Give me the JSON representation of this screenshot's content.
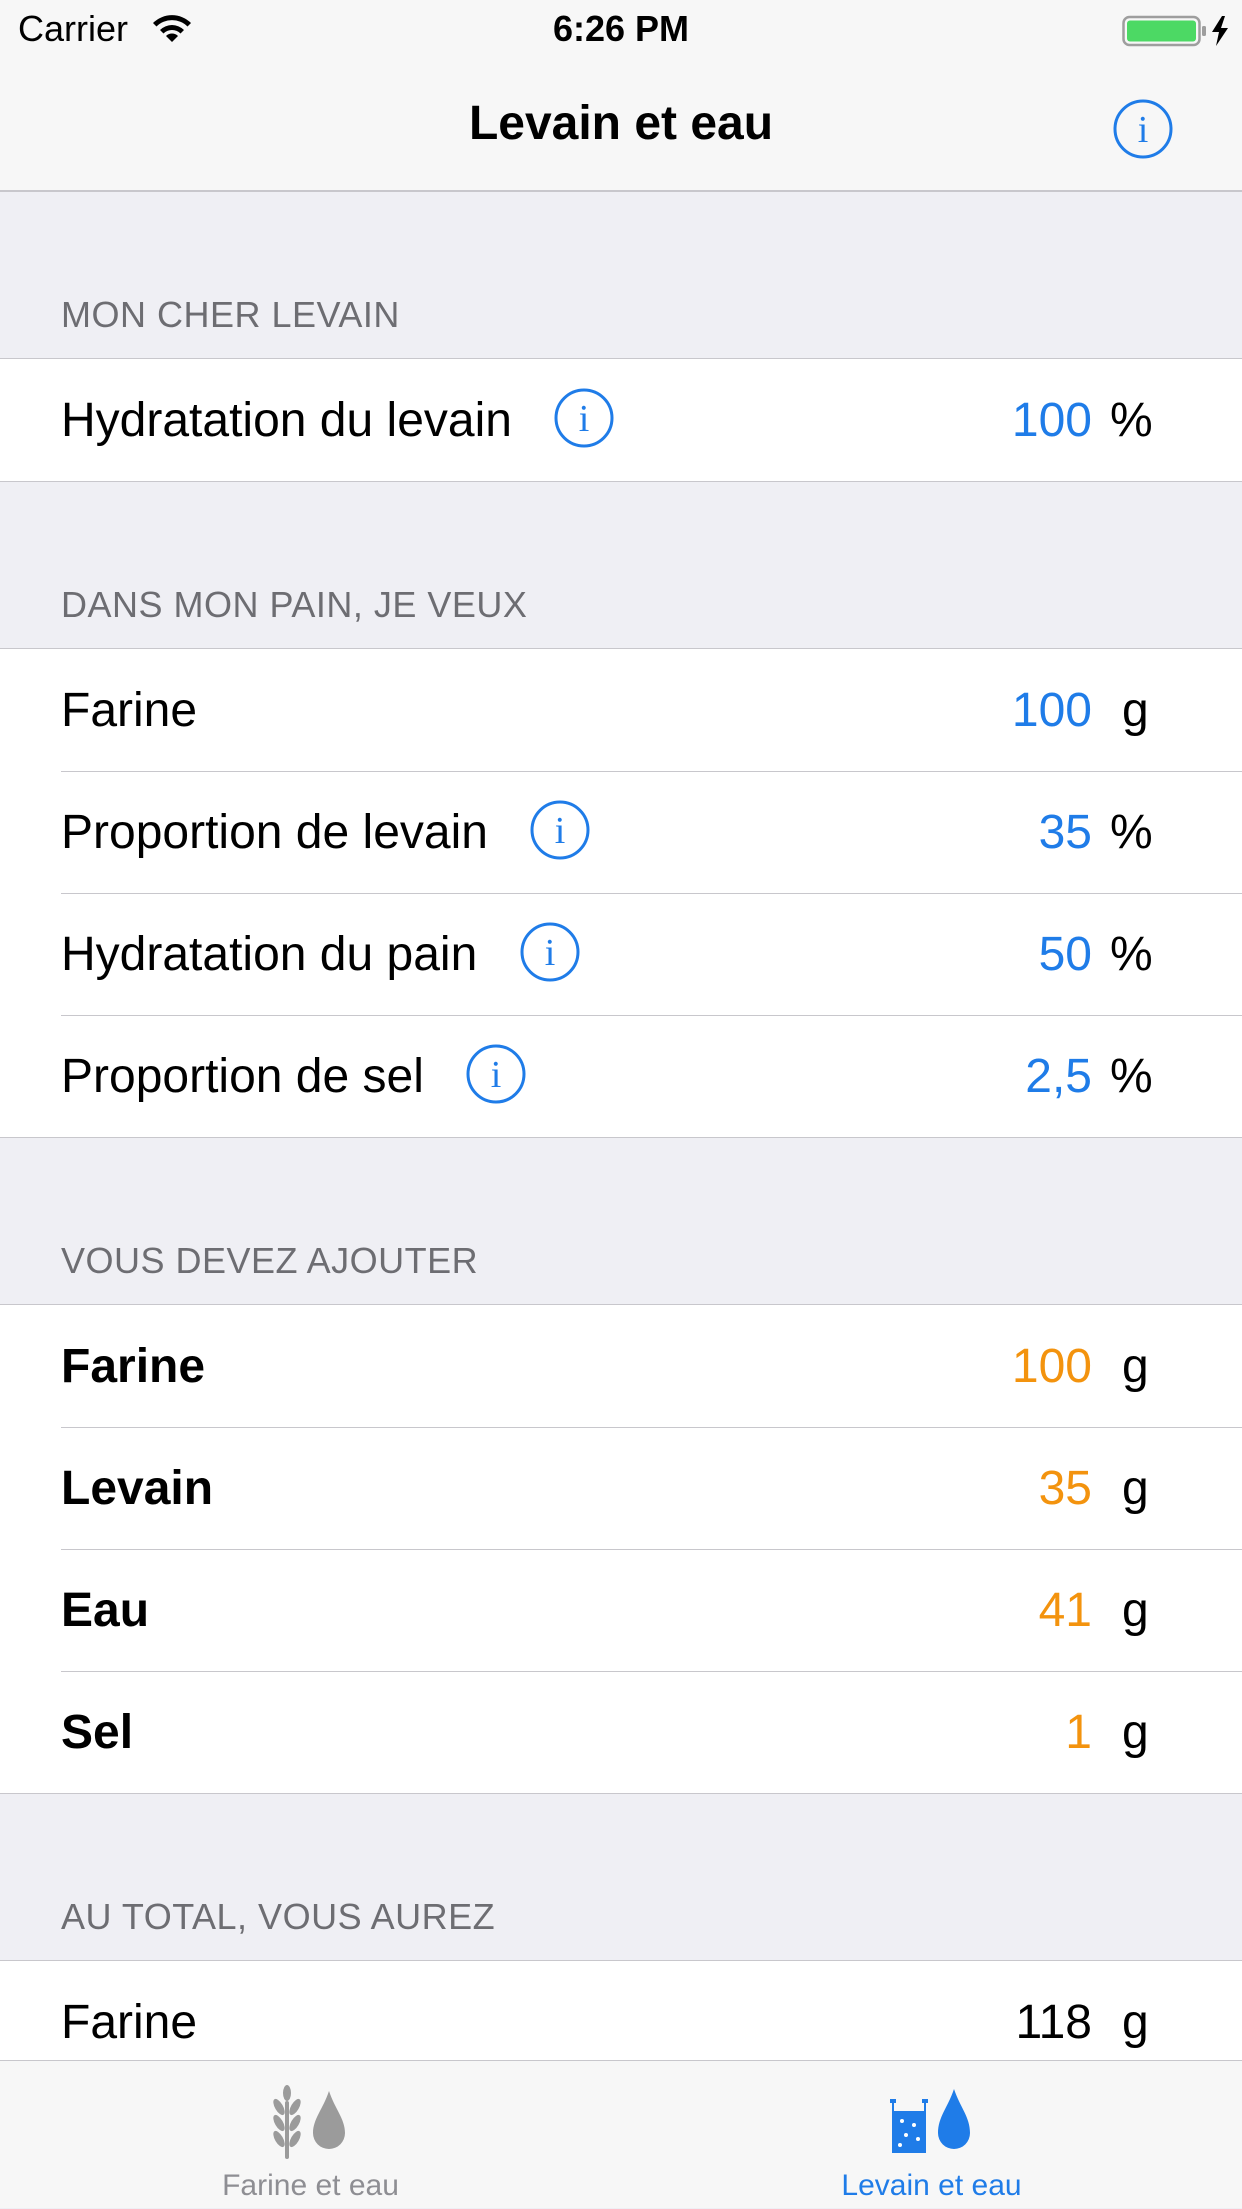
{
  "status_bar": {
    "carrier": "Carrier",
    "time": "6:26 PM",
    "wifi_icon": "wifi-icon",
    "battery_icon": "battery-charging-icon"
  },
  "nav": {
    "title": "Levain et eau",
    "info_icon": "info-icon"
  },
  "sections": [
    {
      "header": "MON CHER LEVAIN",
      "rows": [
        {
          "label": "Hydratation du levain",
          "value": "100",
          "unit": "%",
          "has_info": true
        }
      ]
    },
    {
      "header": "DANS MON PAIN, JE VEUX",
      "rows": [
        {
          "label": "Farine",
          "value": "100",
          "unit": "g",
          "has_info": false
        },
        {
          "label": "Proportion de levain",
          "value": "35",
          "unit": "%",
          "has_info": true
        },
        {
          "label": "Hydratation du pain",
          "value": "50",
          "unit": "%",
          "has_info": true
        },
        {
          "label": "Proportion de sel",
          "value": "2,5",
          "unit": "%",
          "has_info": true
        }
      ]
    },
    {
      "header": "VOUS DEVEZ AJOUTER",
      "rows": [
        {
          "label": "Farine",
          "value": "100",
          "unit": "g"
        },
        {
          "label": "Levain",
          "value": "35",
          "unit": "g"
        },
        {
          "label": "Eau",
          "value": "41",
          "unit": "g"
        },
        {
          "label": "Sel",
          "value": "1",
          "unit": "g"
        }
      ]
    },
    {
      "header": "AU TOTAL, VOUS AUREZ",
      "rows": [
        {
          "label": "Farine",
          "value": "118",
          "unit": "g"
        }
      ]
    }
  ],
  "tab_bar": {
    "tabs": [
      {
        "label": "Farine et eau",
        "icon": "wheat-drop-icon",
        "selected": false
      },
      {
        "label": "Levain et eau",
        "icon": "jar-drop-icon",
        "selected": true
      }
    ]
  },
  "colors": {
    "accent_blue": "#1f7ce8",
    "result_orange": "#f3930e",
    "tab_inactive": "#8e8e93",
    "section_header": "#6d6d72"
  }
}
